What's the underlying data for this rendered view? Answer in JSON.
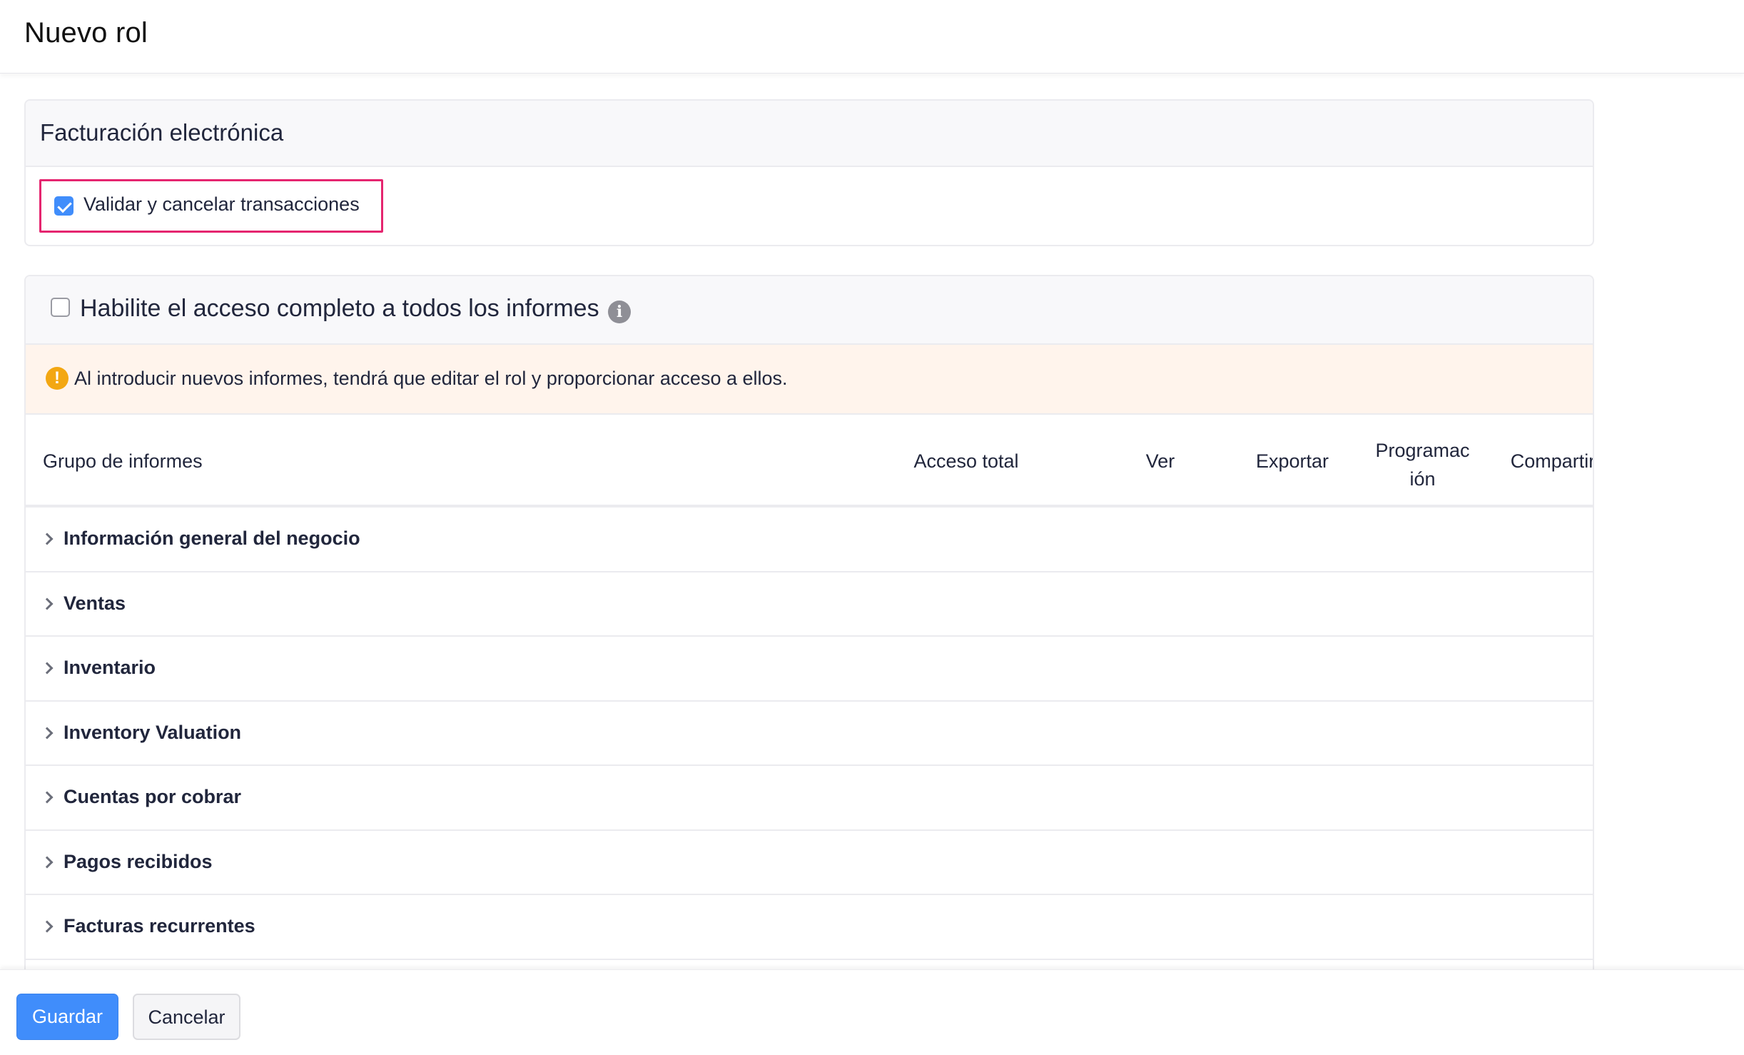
{
  "header": {
    "title": "Nuevo rol"
  },
  "einvoicing": {
    "section_title": "Facturación electrónica",
    "option_label": "Validar y cancelar transacciones",
    "option_checked": true
  },
  "reports": {
    "full_access_label": "Habilite el acceso completo a todos los informes",
    "full_access_checked": false,
    "warning_text": "Al introducir nuevos informes, tendrá que editar el rol y proporcionar acceso a ellos.",
    "columns": {
      "group": "Grupo de informes",
      "full_access": "Acceso total",
      "view": "Ver",
      "export": "Exportar",
      "schedule_line1": "Programac",
      "schedule_line2": "ión",
      "share": "Compartir"
    },
    "groups": [
      {
        "label": "Información general del negocio"
      },
      {
        "label": "Ventas"
      },
      {
        "label": "Inventario"
      },
      {
        "label": "Inventory Valuation"
      },
      {
        "label": "Cuentas por cobrar"
      },
      {
        "label": "Pagos recibidos"
      },
      {
        "label": "Facturas recurrentes"
      }
    ]
  },
  "footer": {
    "save_label": "Guardar",
    "cancel_label": "Cancelar"
  },
  "colors": {
    "accent": "#408dfb",
    "highlight": "#e5256f",
    "warning_bg": "#fff4ec",
    "warning_icon": "#f3a712"
  },
  "icons": {
    "info": "info-icon",
    "warning": "warning-icon",
    "expand": "chevron-right-icon",
    "check": "checkmark-icon"
  }
}
